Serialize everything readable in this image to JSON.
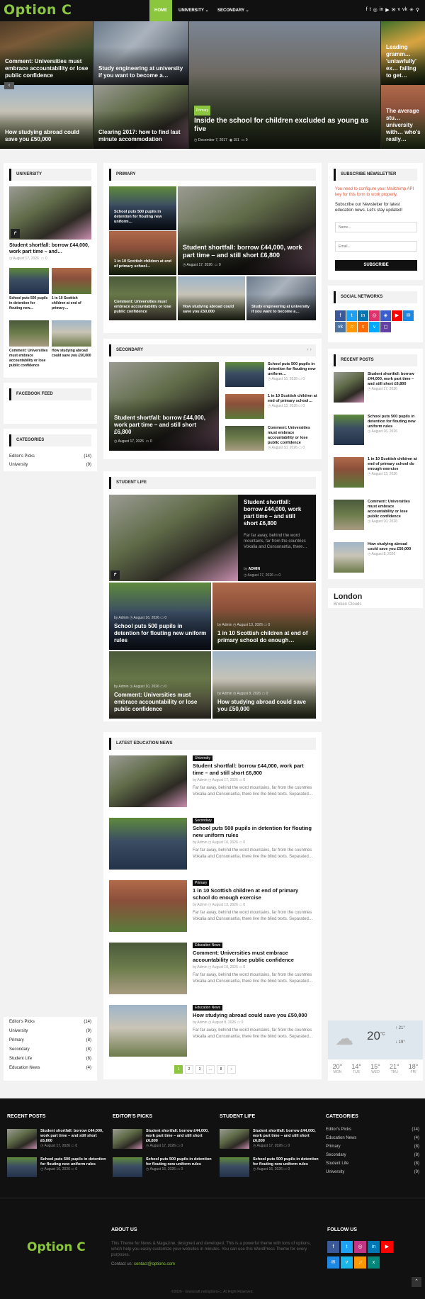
{
  "nav": {
    "logo": "Option C",
    "home": "HOME",
    "university": "UNIVERSITY",
    "secondary": "SECONDARY",
    "icons": [
      "facebook-icon",
      "twitter-icon",
      "instagram-icon",
      "linkedin-icon",
      "youtube-icon",
      "email-icon",
      "vimeo-icon",
      "vk-icon",
      "codepen-icon",
      "search-icon"
    ]
  },
  "hero": {
    "tl": "Comment: Universities must embrace accountability or lose public confidence",
    "bl": "How studying abroad could save you £50,000",
    "tm": "Study engineering at university if you want to become a…",
    "bm": "Clearing 2017: how to find last minute accommodation",
    "center": {
      "tag": "Primary",
      "title": "Inside the school for children excluded as young as five",
      "date": "December 7, 2017",
      "views": "151",
      "comments": "0"
    },
    "rt": "Leading gramm… 'unlawfully' ex… failing to get…",
    "rb": "The average stu… university with… who's really…"
  },
  "university": {
    "head": "UNIVERSITY",
    "main": "Student shortfall: borrow £44,000, work part time – and…",
    "date": "August 17, 2026",
    "comments": "0",
    "items": [
      "School puts 500 pupils in detention for flouting new…",
      "1 in 10 Scottish children at end of primary…",
      "Comment: Universities must embrace accountability or lose public confidence",
      "How studying abroad could save you £50,000"
    ]
  },
  "facebook": {
    "head": "FACEBOOK FEED"
  },
  "categories": {
    "head": "CATEGORIES",
    "items": [
      {
        "name": "Editor's Picks",
        "count": "(14)"
      },
      {
        "name": "University",
        "count": "(9)"
      }
    ]
  },
  "primary": {
    "head": "PRIMARY",
    "big": "Student shortfall: borrow £44,000, work part time – and still short £6,800",
    "bigdate": "August 17, 2026",
    "bigcomments": "0",
    "t1": "School puts 500 pupils in detention for flouting new uniform…",
    "t2": "1 in 10 Scottish children at end of primary school…",
    "b1": "Comment: Universities must embrace accountability or lose public confidence",
    "b2": "How studying abroad could save you £50,000",
    "b3": "Study engineering at university if you want to become a…"
  },
  "secondary": {
    "head": "SECONDARY",
    "big": "Student shortfall: borrow £44,000, work part time – and still short £6,800",
    "bigdate": "August 17, 2026",
    "bigcomments": "0",
    "items": [
      {
        "t": "School puts 500 pupils in detention for flouting new uniform…",
        "d": "August 16, 2026",
        "c": "0"
      },
      {
        "t": "1 in 10 Scottish children at end of primary school…",
        "d": "August 13, 2026",
        "c": "0"
      },
      {
        "t": "Comment: Universities must embrace accountability or lose public confidence",
        "d": "August 10, 2026",
        "c": "0"
      }
    ]
  },
  "studentlife": {
    "head": "STUDENT LIFE",
    "big": "Student shortfall: borrow £44,000, work part time – and still short £6,800",
    "excerpt": "Far far away, behind the word mountains, far from the countries Vokalia and Consonantia, there…",
    "by": "by",
    "author": "ADMIN",
    "date": "August 17, 2026",
    "comments": "0",
    "g1": {
      "t": "School puts 500 pupils in detention for flouting new uniform rules",
      "by": "by Admin",
      "d": "August 16, 2026",
      "c": "0"
    },
    "g2": {
      "t": "1 in 10 Scottish children at end of primary school do enough…",
      "by": "by Admin",
      "d": "August 13, 2026",
      "c": "0"
    },
    "g3": {
      "t": "Comment: Universities must embrace accountability or lose public confidence",
      "by": "by Admin",
      "d": "August 10, 2026",
      "c": "0"
    },
    "g4": {
      "t": "How studying abroad could save you £50,000",
      "by": "by Admin",
      "d": "August 8, 2026",
      "c": "0"
    }
  },
  "latest": {
    "head": "LATEST EDUCATION NEWS",
    "excerpt": "Far far away, behind the word mountains, far from the countries Vokalia and Consonantia, there live the blind texts. Separated…",
    "items": [
      {
        "tag": "University",
        "t": "Student shortfall: borrow £44,000, work part time – and still short £6,800",
        "by": "by Admin",
        "d": "August 17, 2026",
        "c": "0"
      },
      {
        "tag": "Secondary",
        "t": "School puts 500 pupils in detention for flouting new uniform rules",
        "by": "by Admin",
        "d": "August 16, 2026",
        "c": "0"
      },
      {
        "tag": "Primary",
        "t": "1 in 10 Scottish children at end of primary school do enough exercise",
        "by": "by Admin",
        "d": "August 13, 2026",
        "c": "0"
      },
      {
        "tag": "Education News",
        "t": "Comment: Universities must embrace accountability or lose public confidence",
        "by": "by Admin",
        "d": "August 10, 2026",
        "c": "0"
      },
      {
        "tag": "Education News",
        "t": "How studying abroad could save you £50,000",
        "by": "by Admin",
        "d": "August 8, 2026",
        "c": "0"
      }
    ],
    "pages": [
      "1",
      "2",
      "3",
      "…",
      "8",
      "›"
    ]
  },
  "leftcats": [
    {
      "n": "Editor's Picks",
      "c": "(14)"
    },
    {
      "n": "University",
      "c": "(9)"
    },
    {
      "n": "Primary",
      "c": "(8)"
    },
    {
      "n": "Secondary",
      "c": "(8)"
    },
    {
      "n": "Student Life",
      "c": "(8)"
    },
    {
      "n": "Education News",
      "c": "(4)"
    }
  ],
  "subscribe": {
    "head": "SUBSCRIBE NEWSLETTER",
    "warn": "You need to configure your Mailchimp API key for this form to work properly.",
    "text": "Subscribe our Newsletter for latest education news. Let's stay updated!",
    "name": "Name...",
    "email": "Email...",
    "btn": "SUBSCRIBE"
  },
  "social": {
    "head": "SOCIAL NETWORKS",
    "colors": [
      "#3b5998",
      "#1da1f2",
      "#0077b5",
      "#e1306c",
      "#3a5fcd",
      "#ff0000",
      "#1e88e5",
      "#4c75a3",
      "#ff9800",
      "#ff6a00",
      "#00a8ff",
      "#6441a5"
    ]
  },
  "recent": {
    "head": "RECENT POSTS",
    "items": [
      {
        "t": "Student shortfall: borrow £44,000, work part time – and still short £6,800",
        "d": "August 17, 2026"
      },
      {
        "t": "School puts 500 pupils in detention for flouting new uniform rules",
        "d": "August 16, 2026"
      },
      {
        "t": "1 in 10 Scottish children at end of primary school do enough exercise",
        "d": "August 13, 2026"
      },
      {
        "t": "Comment: Universities must embrace accountability or lose public confidence",
        "d": "August 10, 2026"
      },
      {
        "t": "How studying abroad could save you £50,000",
        "d": "August 8, 2026"
      }
    ]
  },
  "weather": {
    "city": "London",
    "desc": "Broken Clouds",
    "temp": "20",
    "unit": "°C",
    "hi": "21°",
    "lo": "19°",
    "days": [
      {
        "t": "20°",
        "d": "MON"
      },
      {
        "t": "14°",
        "d": "TUE"
      },
      {
        "t": "15°",
        "d": "WED"
      },
      {
        "t": "21°",
        "d": "THU"
      },
      {
        "t": "18°",
        "d": "FRI"
      }
    ]
  },
  "footer": {
    "recent": {
      "head": "RECENT POSTS",
      "a": "Student shortfall: borrow £44,000, work part time – and still short £6,800",
      "ad": "August 17, 2026",
      "b": "School puts 500 pupils in detention for flouting new uniform rules",
      "bd": "August 16, 2026"
    },
    "picks": {
      "head": "EDITOR'S PICKS",
      "a": "Student shortfall: borrow £44,000, work part time – and still short £6,800",
      "ad": "August 17, 2026",
      "b": "School puts 500 pupils in detention for flouting new uniform rules",
      "bd": "August 16, 2026"
    },
    "life": {
      "head": "STUDENT LIFE",
      "a": "Student shortfall: borrow £44,000, work part time – and still short £6,800",
      "ad": "August 17, 2026",
      "b": "School puts 500 pupils in detention for flouting new uniform rules",
      "bd": "August 16, 2026"
    },
    "cats": {
      "head": "CATEGORIES",
      "items": [
        {
          "n": "Editor's Picks",
          "c": "(14)"
        },
        {
          "n": "Education News",
          "c": "(4)"
        },
        {
          "n": "Primary",
          "c": "(8)"
        },
        {
          "n": "Secondary",
          "c": "(8)"
        },
        {
          "n": "Student Life",
          "c": "(8)"
        },
        {
          "n": "University",
          "c": "(9)"
        }
      ]
    },
    "logo": "Option C",
    "about": "ABOUT US",
    "abouttext": "This Theme for News & Magazine, designed and developed. This is a powerful theme with tons of options, which help you easily customize your websites in minutes. You can use this WordPress Theme for every purposes.",
    "contact": "Contact us:",
    "email": "contact@optionc.com",
    "follow": "FOLLOW US",
    "copy": "©2026 - newscraft.net/options-c. All Right Reserved.",
    "fcolors": [
      "#3b5998",
      "#1da1f2",
      "#c13584",
      "#0077b5",
      "#ff0000",
      "#1e88e5",
      "#1ab7ea",
      "#ff9800",
      "#00897b"
    ]
  }
}
